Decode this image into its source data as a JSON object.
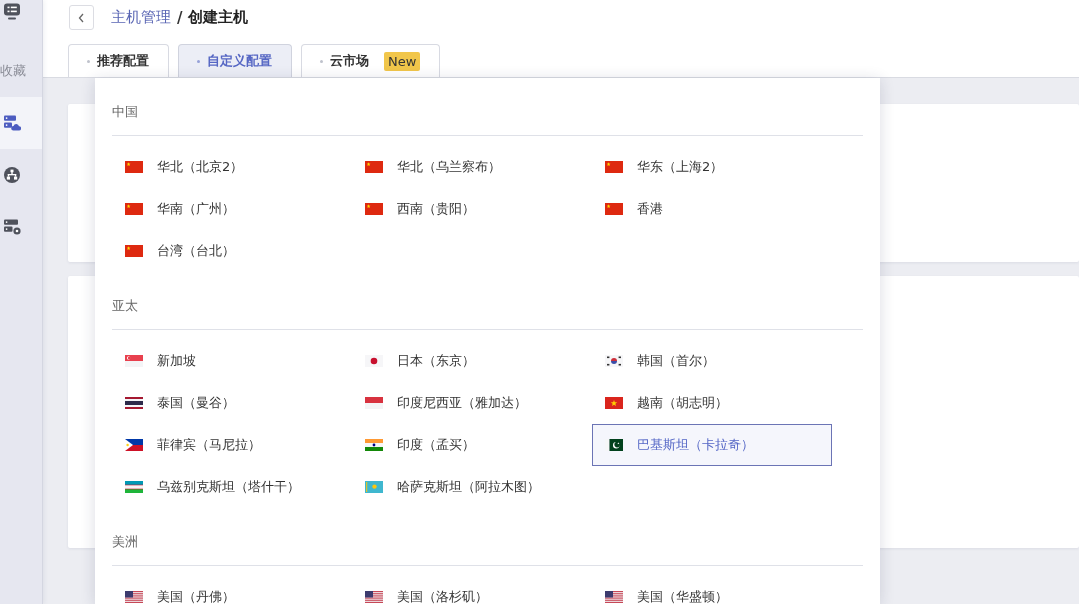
{
  "sidebar": {
    "items": [
      {
        "kind": "display",
        "selected": false
      },
      {
        "kind": "text",
        "label": "收藏",
        "selected": false
      },
      {
        "kind": "cloud",
        "selected": true
      },
      {
        "kind": "network",
        "selected": false
      },
      {
        "kind": "servers",
        "selected": false
      }
    ]
  },
  "breadcrumb": {
    "parent": "主机管理",
    "separator": "/",
    "current": "创建主机"
  },
  "tabs": [
    {
      "label": "推荐配置",
      "selected": false
    },
    {
      "label": "自定义配置",
      "selected": true
    },
    {
      "label": "云市场",
      "badge": "New",
      "selected": false
    }
  ],
  "region_dropdown": {
    "groups": [
      {
        "title": "中国",
        "regions": [
          {
            "name": "华北（北京2）",
            "kind": "cn",
            "selected": false
          },
          {
            "name": "华北（乌兰察布）",
            "kind": "cn",
            "selected": false
          },
          {
            "name": "华东（上海2）",
            "kind": "cn",
            "selected": false
          },
          {
            "name": "华南（广州）",
            "kind": "cn",
            "selected": false
          },
          {
            "name": "西南（贵阳）",
            "kind": "cn",
            "selected": false
          },
          {
            "name": "香港",
            "kind": "cn",
            "selected": false
          },
          {
            "name": "台湾（台北）",
            "kind": "cn",
            "selected": false
          }
        ]
      },
      {
        "title": "亚太",
        "regions": [
          {
            "name": "新加坡",
            "kind": "sg",
            "selected": false
          },
          {
            "name": "日本（东京）",
            "kind": "jp",
            "selected": false
          },
          {
            "name": "韩国（首尔）",
            "kind": "kr",
            "selected": false
          },
          {
            "name": "泰国（曼谷）",
            "kind": "th",
            "selected": false
          },
          {
            "name": "印度尼西亚（雅加达）",
            "kind": "id",
            "selected": false
          },
          {
            "name": "越南（胡志明）",
            "kind": "vn",
            "selected": false
          },
          {
            "name": "菲律宾（马尼拉）",
            "kind": "ph",
            "selected": false
          },
          {
            "name": "印度（孟买）",
            "kind": "in",
            "selected": false
          },
          {
            "name": "巴基斯坦（卡拉奇）",
            "kind": "pk",
            "selected": true
          },
          {
            "name": "乌兹别克斯坦（塔什干）",
            "kind": "uz",
            "selected": false
          },
          {
            "name": "哈萨克斯坦（阿拉木图）",
            "kind": "kz",
            "selected": false
          }
        ]
      },
      {
        "title": "美洲",
        "regions": [
          {
            "name": "美国（丹佛）",
            "kind": "us",
            "selected": false
          },
          {
            "name": "美国（洛杉矶）",
            "kind": "us",
            "selected": false
          },
          {
            "name": "美国（华盛顿）",
            "kind": "us",
            "selected": false
          }
        ]
      }
    ]
  }
}
